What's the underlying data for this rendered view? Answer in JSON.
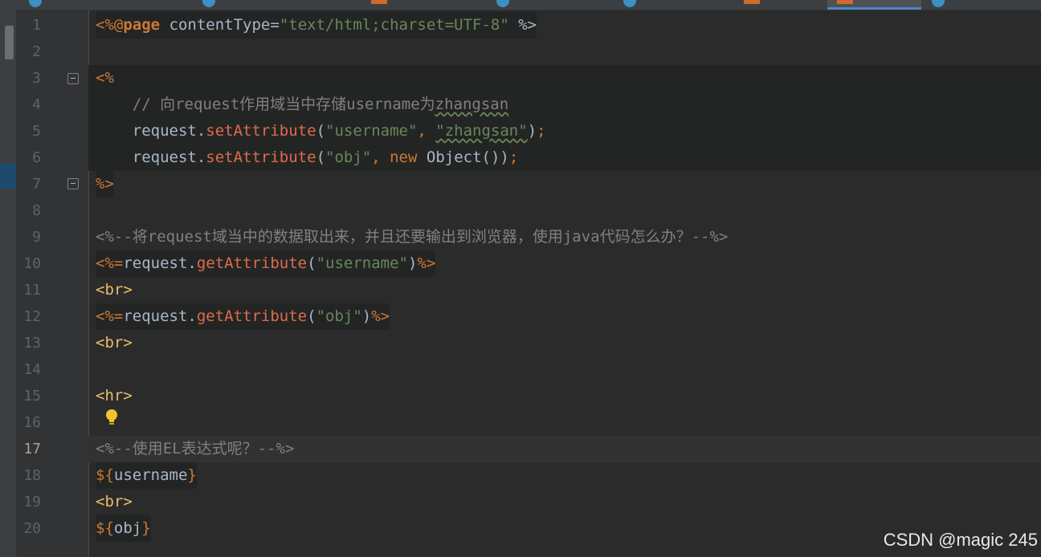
{
  "lines": [
    {
      "n": "1",
      "text": "<%@page contentType=\"text/html;charset=UTF-8\" %>"
    },
    {
      "n": "2",
      "text": ""
    },
    {
      "n": "3",
      "text": "<%"
    },
    {
      "n": "4",
      "text": "    // 向request作用域当中存储username为zhangsan"
    },
    {
      "n": "5",
      "text": "    request.setAttribute(\"username\", \"zhangsan\");"
    },
    {
      "n": "6",
      "text": "    request.setAttribute(\"obj\", new Object());"
    },
    {
      "n": "7",
      "text": "%>"
    },
    {
      "n": "8",
      "text": ""
    },
    {
      "n": "9",
      "text": "<%--将request域当中的数据取出来，并且还要输出到浏览器，使用java代码怎么办？--%>"
    },
    {
      "n": "10",
      "text": "<%=request.getAttribute(\"username\")%>"
    },
    {
      "n": "11",
      "text": "<br>"
    },
    {
      "n": "12",
      "text": "<%=request.getAttribute(\"obj\")%>"
    },
    {
      "n": "13",
      "text": "<br>"
    },
    {
      "n": "14",
      "text": ""
    },
    {
      "n": "15",
      "text": "<hr>"
    },
    {
      "n": "16",
      "text": ""
    },
    {
      "n": "17",
      "text": "<%--使用EL表达式呢？--%>"
    },
    {
      "n": "18",
      "text": "${username}"
    },
    {
      "n": "19",
      "text": "<br>"
    },
    {
      "n": "20",
      "text": "${obj}"
    }
  ],
  "current_line": "17",
  "watermark": "CSDN @magic 245",
  "colors": {
    "background": "#2b2b2b",
    "keyword": "#cc7832",
    "string": "#6a8759",
    "tag": "#e8bf6a",
    "comment": "#808080"
  }
}
